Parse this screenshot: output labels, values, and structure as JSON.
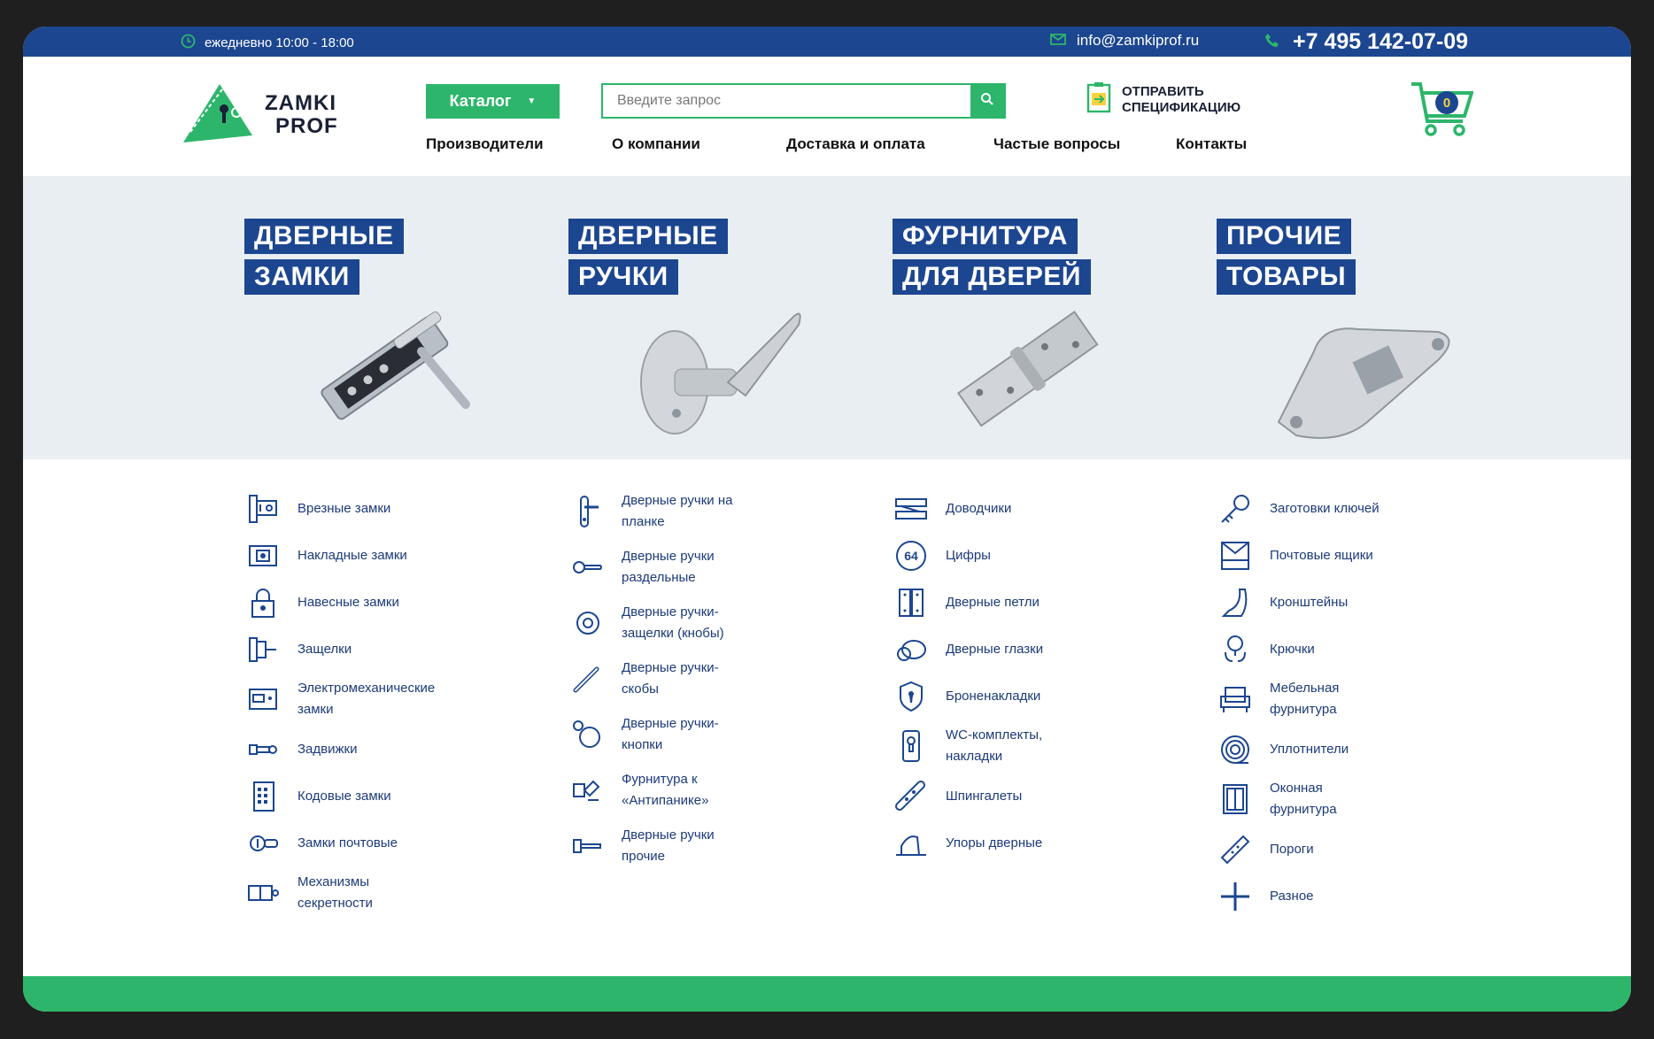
{
  "topbar": {
    "hours": "ежедневно 10:00 - 18:00",
    "email": "info@zamkiprof.ru",
    "phone": "+7 495 142-07-09"
  },
  "header": {
    "logo_line1": "ZAMKI",
    "logo_line2": "PROF",
    "catalog_label": "Каталог",
    "search_placeholder": "Введите запрос",
    "spec_line1": "ОТПРАВИТЬ",
    "spec_line2": "СПЕЦИФИКАЦИЮ",
    "cart_count": "0",
    "nav": [
      "Производители",
      "О компании",
      "Доставка и оплата",
      "Частые вопросы",
      "Контакты"
    ]
  },
  "categories": [
    {
      "line1": "ДВЕРНЫЕ",
      "line2": "ЗАМКИ"
    },
    {
      "line1": "ДВЕРНЫЕ",
      "line2": "РУЧКИ"
    },
    {
      "line1": "ФУРНИТУРА",
      "line2": "ДЛЯ ДВЕРЕЙ"
    },
    {
      "line1": "ПРОЧИЕ",
      "line2": "ТОВАРЫ"
    }
  ],
  "lists": {
    "locks": [
      {
        "label": "Врезные замки",
        "icon": "mortise-lock-icon"
      },
      {
        "label": "Накладные замки",
        "icon": "rim-lock-icon"
      },
      {
        "label": "Навесные замки",
        "icon": "padlock-icon"
      },
      {
        "label": "Защелки",
        "icon": "latch-icon"
      },
      {
        "label": "Электромеханические замки",
        "icon": "electromechanical-lock-icon"
      },
      {
        "label": "Задвижки",
        "icon": "bolt-icon"
      },
      {
        "label": "Кодовые замки",
        "icon": "keypad-lock-icon"
      },
      {
        "label": "Замки почтовые",
        "icon": "mailbox-lock-icon"
      },
      {
        "label": "Механизмы секретности",
        "icon": "cylinder-icon"
      }
    ],
    "handles": [
      {
        "label": "Дверные ручки на планке",
        "icon": "plate-handle-icon"
      },
      {
        "label": "Дверные ручки раздельные",
        "icon": "rosette-handle-icon"
      },
      {
        "label": "Дверные ручки-защелки (кнобы)",
        "icon": "knob-latch-icon"
      },
      {
        "label": "Дверные ручки-скобы",
        "icon": "pull-handle-icon"
      },
      {
        "label": "Дверные ручки-кнопки",
        "icon": "knob-icon"
      },
      {
        "label": "Фурнитура к «Антипанике»",
        "icon": "panic-bar-icon"
      },
      {
        "label": "Дверные ручки прочие",
        "icon": "other-handle-icon"
      }
    ],
    "fittings": [
      {
        "label": "Доводчики",
        "icon": "door-closer-icon"
      },
      {
        "label": "Цифры",
        "icon": "number-icon"
      },
      {
        "label": "Дверные петли",
        "icon": "hinge-icon"
      },
      {
        "label": "Дверные глазки",
        "icon": "peephole-icon"
      },
      {
        "label": "Броненакладки",
        "icon": "armor-plate-icon"
      },
      {
        "label": "WC-комплекты, накладки",
        "icon": "wc-set-icon"
      },
      {
        "label": "Шпингалеты",
        "icon": "bolt-latch-icon"
      },
      {
        "label": "Упоры дверные",
        "icon": "door-stop-icon"
      }
    ],
    "other": [
      {
        "label": "Заготовки ключей",
        "icon": "key-blank-icon"
      },
      {
        "label": "Почтовые ящики",
        "icon": "mailbox-icon"
      },
      {
        "label": "Кронштейны",
        "icon": "bracket-icon"
      },
      {
        "label": "Крючки",
        "icon": "hook-icon"
      },
      {
        "label": "Мебельная фурнитура",
        "icon": "furniture-icon"
      },
      {
        "label": "Уплотнители",
        "icon": "seal-icon"
      },
      {
        "label": "Оконная фурнитура",
        "icon": "window-icon"
      },
      {
        "label": "Пороги",
        "icon": "threshold-icon"
      },
      {
        "label": "Разное",
        "icon": "misc-icon"
      }
    ]
  },
  "colors": {
    "brand_blue": "#1c4690",
    "brand_green": "#2db66b",
    "banner_bg": "#e9eef2"
  }
}
